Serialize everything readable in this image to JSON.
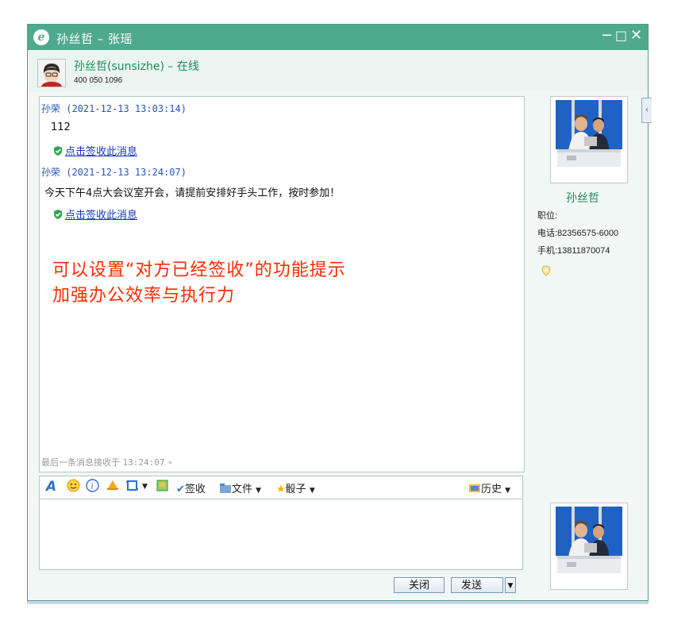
{
  "window": {
    "title": "孙丝哲 – 张瑶",
    "controls": {
      "minimize": "−",
      "maximize": "□",
      "close": "✕"
    }
  },
  "contact": {
    "display": "孙丝哲(sunsizhe) – 在线",
    "phone": "400 050 1096"
  },
  "messages": [
    {
      "header": "孙荣 (2021-12-13 13:03:14)",
      "body": "112",
      "sign_link": "点击签收此消息"
    },
    {
      "header": "孙荣 (2021-12-13 13:24:07)",
      "body": "今天下午4点大会议室开会，请提前安排好手头工作，按时参加！",
      "sign_link": "点击签收此消息"
    }
  ],
  "promo": {
    "line1": "可以设置“对方已经签收”的功能提示",
    "line2": "加强办公效率与执行力"
  },
  "last_received": {
    "label": "最后一条消息接收于",
    "time": "13:24:07",
    "mark": "∘"
  },
  "toolbar": {
    "sign": "签收",
    "file": "文件",
    "dice": "骰子",
    "history": "历史"
  },
  "buttons": {
    "close": "关闭",
    "send": "发送"
  },
  "profile": {
    "name": "孙丝哲",
    "position_label": "职位:",
    "phone": "电话:82356575-6000",
    "mobile": "手机:13811870074"
  },
  "colors": {
    "titlebar": "#4fa98c",
    "link": "#1535c0",
    "header_text": "#2656c0",
    "promo": "#ff2a00",
    "name_green": "#1c8a5a"
  }
}
